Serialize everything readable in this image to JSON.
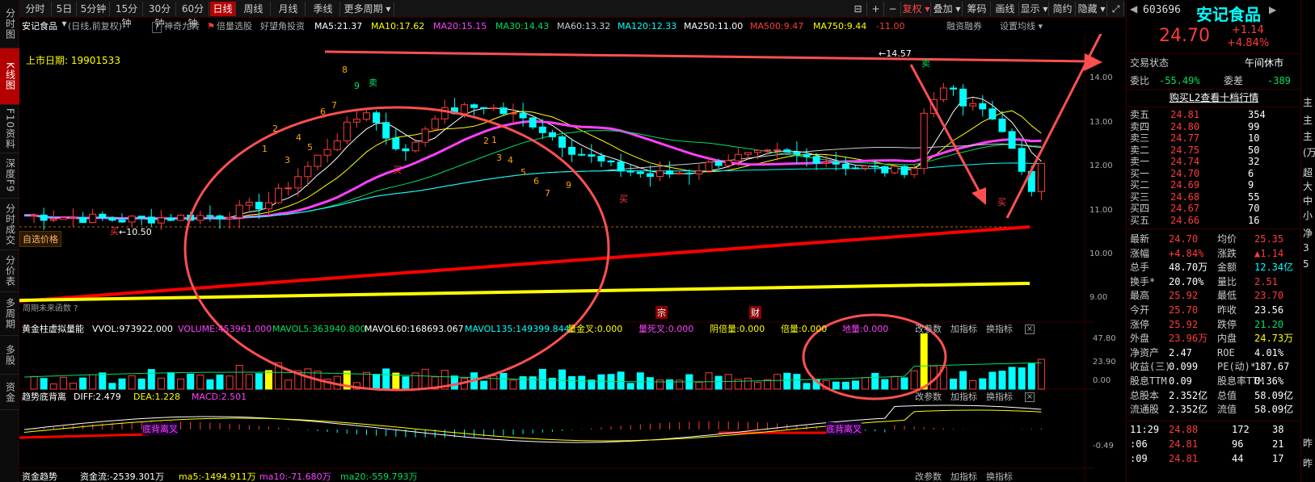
{
  "nav": {
    "items": [
      "分时图",
      "K线图",
      "F10资料",
      "深度F9",
      "分时成交",
      "分价表",
      "多周期",
      "多股",
      "资金"
    ],
    "active": 1
  },
  "toolbar": {
    "periods": [
      "分时",
      "5日 ▾",
      "5分钟",
      "15分钟",
      "30分钟",
      "60分钟",
      "日线",
      "周线",
      "月线",
      "季线",
      "更多周期 ▾"
    ],
    "active": "日线",
    "tools": [
      "⊟",
      "+",
      "−",
      "复权 ▾",
      "叠加 ▾",
      "筹码",
      "画线",
      "显示 ▾",
      "简约",
      "隐藏 ▾",
      "⤢"
    ]
  },
  "info": {
    "name": "安记食品",
    "mode": "(日线,前复权)",
    "help": "?",
    "tool1": "神奇九转",
    "tool2": "倍量选股",
    "tool3": "好望角投资",
    "ma5": "MA5:21.37",
    "ma10": "MA10:17.62",
    "ma20": "MA20:15.15",
    "ma30": "MA30:14.43",
    "ma60": "MA60:13.32",
    "ma120": "MA120:12.33",
    "ma250": "MA250:11.00",
    "ma500": "MA500:9.47",
    "ma750": "MA750:9.44",
    "ma_last": "-11.00",
    "margin": "融资融券",
    "setting": "设置均线 ▾"
  },
  "chart": {
    "listing_label": "上市日期:",
    "listing_date": "19901533",
    "hi_marker": "←14.57",
    "lo_marker": "←10.50",
    "zixuan": "自选价格",
    "note": "周期未来函数 ?",
    "flag1": "宗",
    "flag2": "财",
    "yaxis": [
      "14.00",
      "13.00",
      "12.00",
      "11.00",
      "10.00",
      "9.00"
    ],
    "buy": "买",
    "sell": "卖"
  },
  "vol": {
    "name": "黄金柱虚拟量能",
    "vvol": "VVOL:973922.000",
    "volume": "VOLUME:453961.000",
    "mavol5": "MAVOL5:363940.800",
    "mavol60": "MAVOL60:168693.067",
    "mavol135": "MAVOL135:149399.844",
    "jincha": "量金叉:0.000",
    "sicha": "量死叉:0.000",
    "yinbei": "阴倍量:0.000",
    "beiliang": "倍量:0.000",
    "diliang": "地量:0.000",
    "yaxis": [
      "47.80",
      "23.90",
      "0.00"
    ]
  },
  "macd": {
    "name": "趋势底背离",
    "diff": "DIFF:2.479",
    "dea": "DEA:1.228",
    "macd": "MACD:2.501",
    "lbl1": "底背离叉",
    "lbl2": "底背离叉",
    "yaxis": [
      "-0.49"
    ]
  },
  "fund": {
    "name": "资金趋势",
    "value": "资金流:-2539.301万",
    "ma5": "ma5:-1494.911万",
    "ma10": "ma10:-71.680万",
    "ma20": "ma20:-559.793万"
  },
  "panel_btns": [
    "改参数",
    "加指标",
    "换指标"
  ],
  "quote": {
    "code": "603696",
    "name": "安记食品",
    "price": "24.70",
    "chg": "+1.14",
    "pct": "+4.84%",
    "status": "交易状态",
    "status_val": "午间休市",
    "weibi_l": "委比",
    "weibi": "-55.49%",
    "weicha_l": "委差",
    "weicha": "-389",
    "l2": "购买L2查看十档行情",
    "asks": [
      [
        "卖五",
        "24.81",
        "354"
      ],
      [
        "卖四",
        "24.80",
        "99"
      ],
      [
        "卖三",
        "24.77",
        "10"
      ],
      [
        "卖二",
        "24.75",
        "50"
      ],
      [
        "卖一",
        "24.74",
        "32"
      ]
    ],
    "bids": [
      [
        "买一",
        "24.70",
        "6"
      ],
      [
        "买二",
        "24.69",
        "9"
      ],
      [
        "买三",
        "24.68",
        "55"
      ],
      [
        "买四",
        "24.67",
        "70"
      ],
      [
        "买五",
        "24.66",
        "16"
      ]
    ],
    "stats": [
      [
        "最新",
        "24.70",
        "均价",
        "25.35"
      ],
      [
        "涨幅",
        "+4.84%",
        "涨跌",
        "▲1.14"
      ],
      [
        "总手",
        "48.70万",
        "金额",
        "12.34亿"
      ],
      [
        "换手*",
        "20.70%",
        "量比",
        "2.51"
      ],
      [
        "最高",
        "25.92",
        "最低",
        "23.70"
      ],
      [
        "今开",
        "25.70",
        "昨收",
        "23.56"
      ],
      [
        "涨停",
        "25.92",
        "跌停",
        "21.20"
      ],
      [
        "外盘",
        "23.96万",
        "内盘",
        "24.73万"
      ],
      [
        "净资产",
        "2.47",
        "ROE",
        "4.01%"
      ],
      [
        "收益(三)",
        "0.099",
        "PE(动)*",
        "187.67"
      ],
      [
        "股息TTM",
        "0.09",
        "股息率TTM",
        "0.36%"
      ],
      [
        "总股本",
        "2.352亿",
        "总值",
        "58.09亿"
      ],
      [
        "流通股",
        "2.352亿",
        "流值",
        "58.09亿"
      ]
    ],
    "ticks": [
      [
        "11:29",
        "24.88",
        "172",
        "38"
      ],
      [
        ":06",
        "24.81",
        "96",
        "21"
      ],
      [
        ":09",
        "24.81",
        "44",
        "17"
      ]
    ]
  },
  "far": [
    "主",
    "主",
    "主",
    "(万",
    "超",
    "大",
    "中",
    "小",
    "净",
    "3",
    "5",
    "昨",
    "昨"
  ]
}
